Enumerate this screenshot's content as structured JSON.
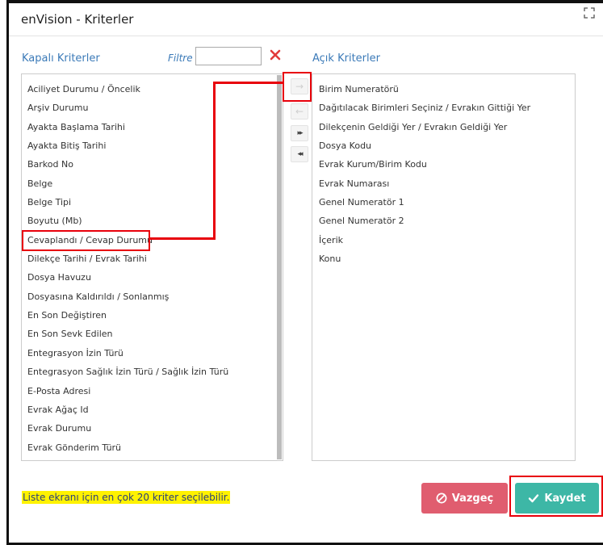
{
  "dialog": {
    "title": "enVision - Kriterler",
    "closed_criteria_title": "Kapalı Kriterler",
    "open_criteria_title": "Açık Kriterler",
    "filter_label": "Filtre",
    "filter_value": ""
  },
  "closed_criteria": [
    "Aciliyet Durumu / Öncelik",
    "Arşiv Durumu",
    "Ayakta Başlama Tarihi",
    "Ayakta Bitiş Tarihi",
    "Barkod No",
    "Belge",
    "Belge Tipi",
    "Boyutu (Mb)",
    "Cevaplandı / Cevap Durumu",
    "Dilekçe Tarihi / Evrak Tarihi",
    "Dosya Havuzu",
    "Dosyasına Kaldırıldı / Sonlanmış",
    "En Son Değiştiren",
    "En Son Sevk Edilen",
    "Entegrasyon İzin Türü",
    "Entegrasyon Sağlık İzin Türü / Sağlık İzin Türü",
    "E-Posta Adresi",
    "Evrak Ağaç Id",
    "Evrak Durumu",
    "Evrak Gönderim Türü"
  ],
  "open_criteria": [
    "Birim Numeratörü",
    "Dağıtılacak Birimleri Seçiniz / Evrakın Gittiği Yer",
    "Dilekçenin Geldiği Yer / Evrakın Geldiği Yer",
    "Dosya Kodu",
    "Evrak Kurum/Birim Kodu",
    "Evrak Numarası",
    "Genel Numeratör 1",
    "Genel Numeratör 2",
    "İçerik",
    "Konu"
  ],
  "move_buttons": {
    "move_right": "→",
    "move_left": "←",
    "move_all_right": "▸▸",
    "move_all_left": "◂◂"
  },
  "footer": {
    "note": "Liste ekranı için en çok 20 kriter seçilebilir.",
    "cancel_label": "Vazgeç",
    "save_label": "Kaydet"
  },
  "colors": {
    "accent_blue": "#3b7ab8",
    "cancel": "#e05d6f",
    "save": "#3db7a6",
    "annotation_red": "#e8000b",
    "note_highlight": "#fff200"
  },
  "icons": {
    "expand": "expand-icon",
    "clear": "close-icon",
    "cancel": "ban-icon",
    "save": "check-icon"
  }
}
